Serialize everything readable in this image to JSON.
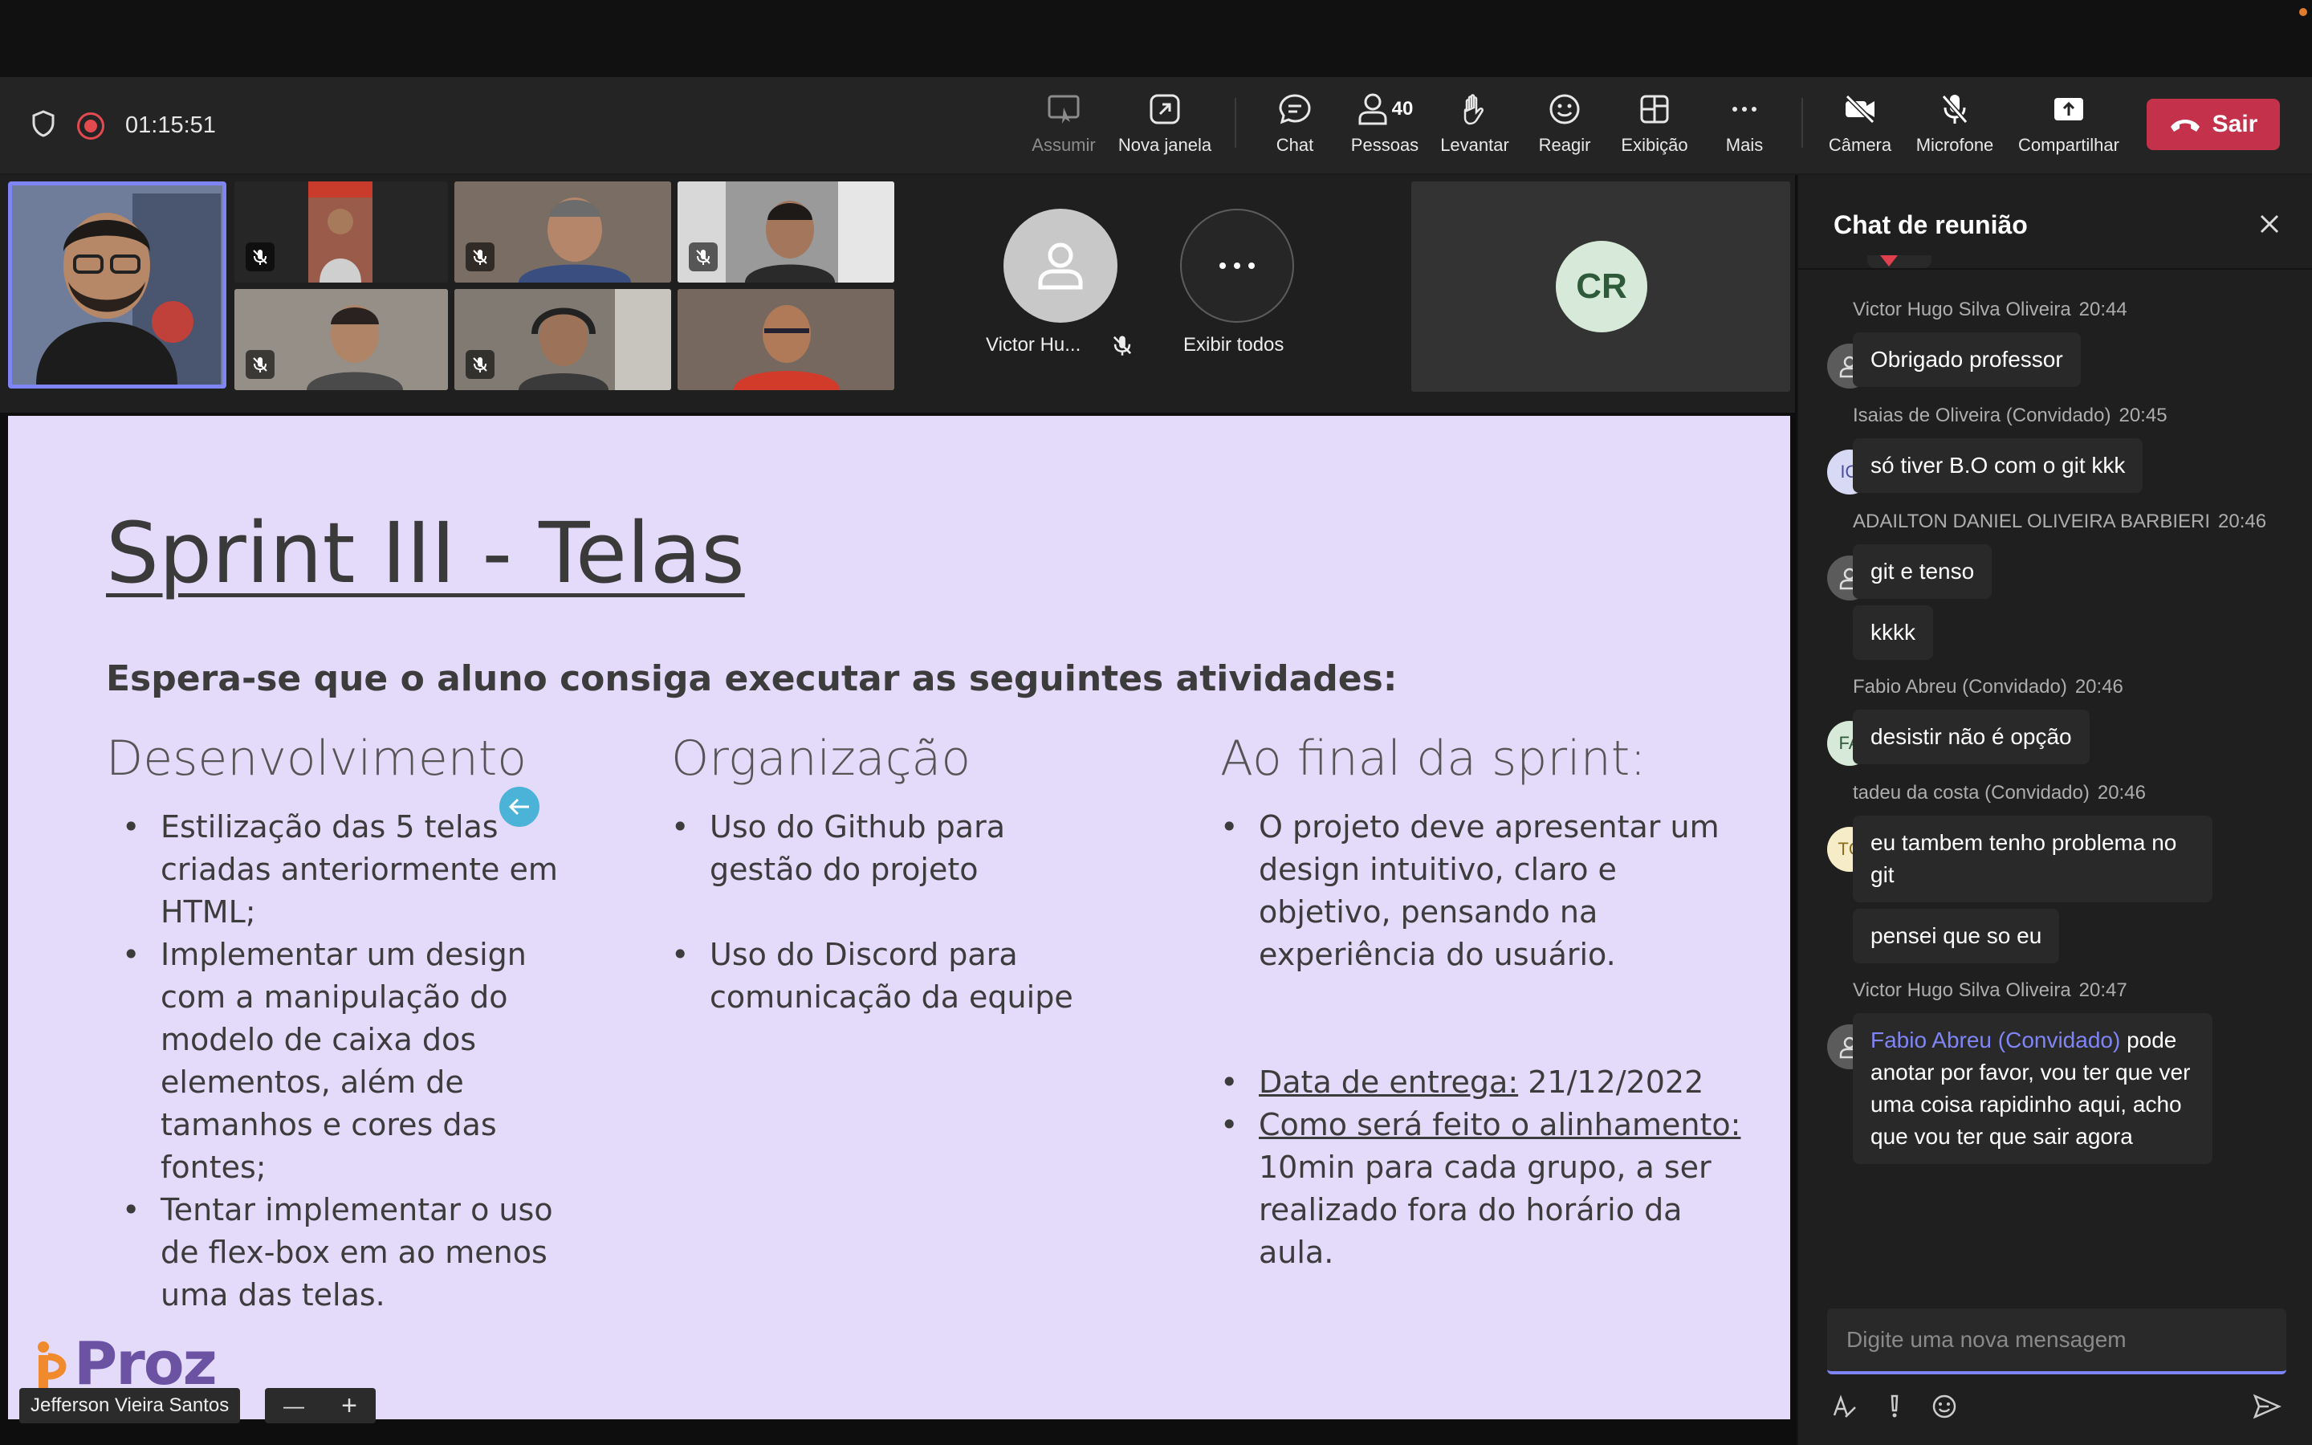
{
  "toolbar": {
    "timer": "01:15:51",
    "items": [
      {
        "label": "Assumir"
      },
      {
        "label": "Nova janela"
      },
      {
        "label": "Chat"
      },
      {
        "label": "Pessoas",
        "count": "40"
      },
      {
        "label": "Levantar"
      },
      {
        "label": "Reagir"
      },
      {
        "label": "Exibição"
      },
      {
        "label": "Mais"
      },
      {
        "label": "Câmera"
      },
      {
        "label": "Microfone"
      },
      {
        "label": "Compartilhar"
      }
    ],
    "leave_label": "Sair"
  },
  "gallery": {
    "participant_name": "Victor Hu...",
    "show_all": "Exibir todos",
    "cr_initials": "CR"
  },
  "slide": {
    "title": "Sprint III - Telas",
    "subtitle": "Espera-se que o aluno consiga executar as seguintes atividades:",
    "col1_head": "Desenvolvimento",
    "col1_bullets": [
      "Estilização das 5 telas criadas anteriormente em HTML;",
      "Implementar um design com a manipulação do modelo de caixa dos elementos, além de tamanhos e cores das fontes;",
      "Tentar implementar o uso de flex-box em ao menos uma das telas."
    ],
    "col2_head": "Organização",
    "col2_bullets": [
      "Uso do Github para gestão do projeto",
      "Uso do Discord para comunicação da equipe"
    ],
    "col3_head": "Ao final da sprint:",
    "col3_bullet1": "O projeto deve apresentar um design intuitivo, claro e objetivo, pensando na experiência do usuário.",
    "col3_bullet2_label": "Data de entrega:",
    "col3_bullet2_value": " 21/12/2022",
    "col3_bullet3_label": "Como será feito o alinhamento: ",
    "col3_bullet3_value": "10min para cada grupo, a ser realizado fora do horário da aula.",
    "logo_text": "Proz",
    "presenter": "Jefferson Vieira Santos",
    "zoom_minus": "—",
    "zoom_plus": "+"
  },
  "chat": {
    "title": "Chat de reunião",
    "placeholder": "Digite uma nova mensagem",
    "messages": [
      {
        "author": "Victor Hugo Silva Oliveira",
        "time": "20:44",
        "text": "Obrigado professor"
      },
      {
        "author": "Isaias de Oliveira (Convidado)",
        "time": "20:45",
        "initials": "IO",
        "text": "só tiver B.O com o git kkk"
      },
      {
        "author": "ADAILTON DANIEL OLIVEIRA BARBIERI",
        "time": "20:46",
        "text": "git e tenso",
        "text2": "kkkk"
      },
      {
        "author": "Fabio Abreu (Convidado)",
        "time": "20:46",
        "initials": "FA",
        "text": "desistir não é opção"
      },
      {
        "author": "tadeu da costa (Convidado)",
        "time": "20:46",
        "initials": "TC",
        "text": "eu tambem tenho problema no git",
        "text2": "pensei que so eu"
      },
      {
        "author": "Victor Hugo Silva Oliveira",
        "time": "20:47",
        "mention": "Fabio Abreu (Convidado)",
        "text": " pode anotar por favor, vou ter que ver uma coisa rapidinho aqui, acho que vou ter que sair agora"
      }
    ]
  }
}
